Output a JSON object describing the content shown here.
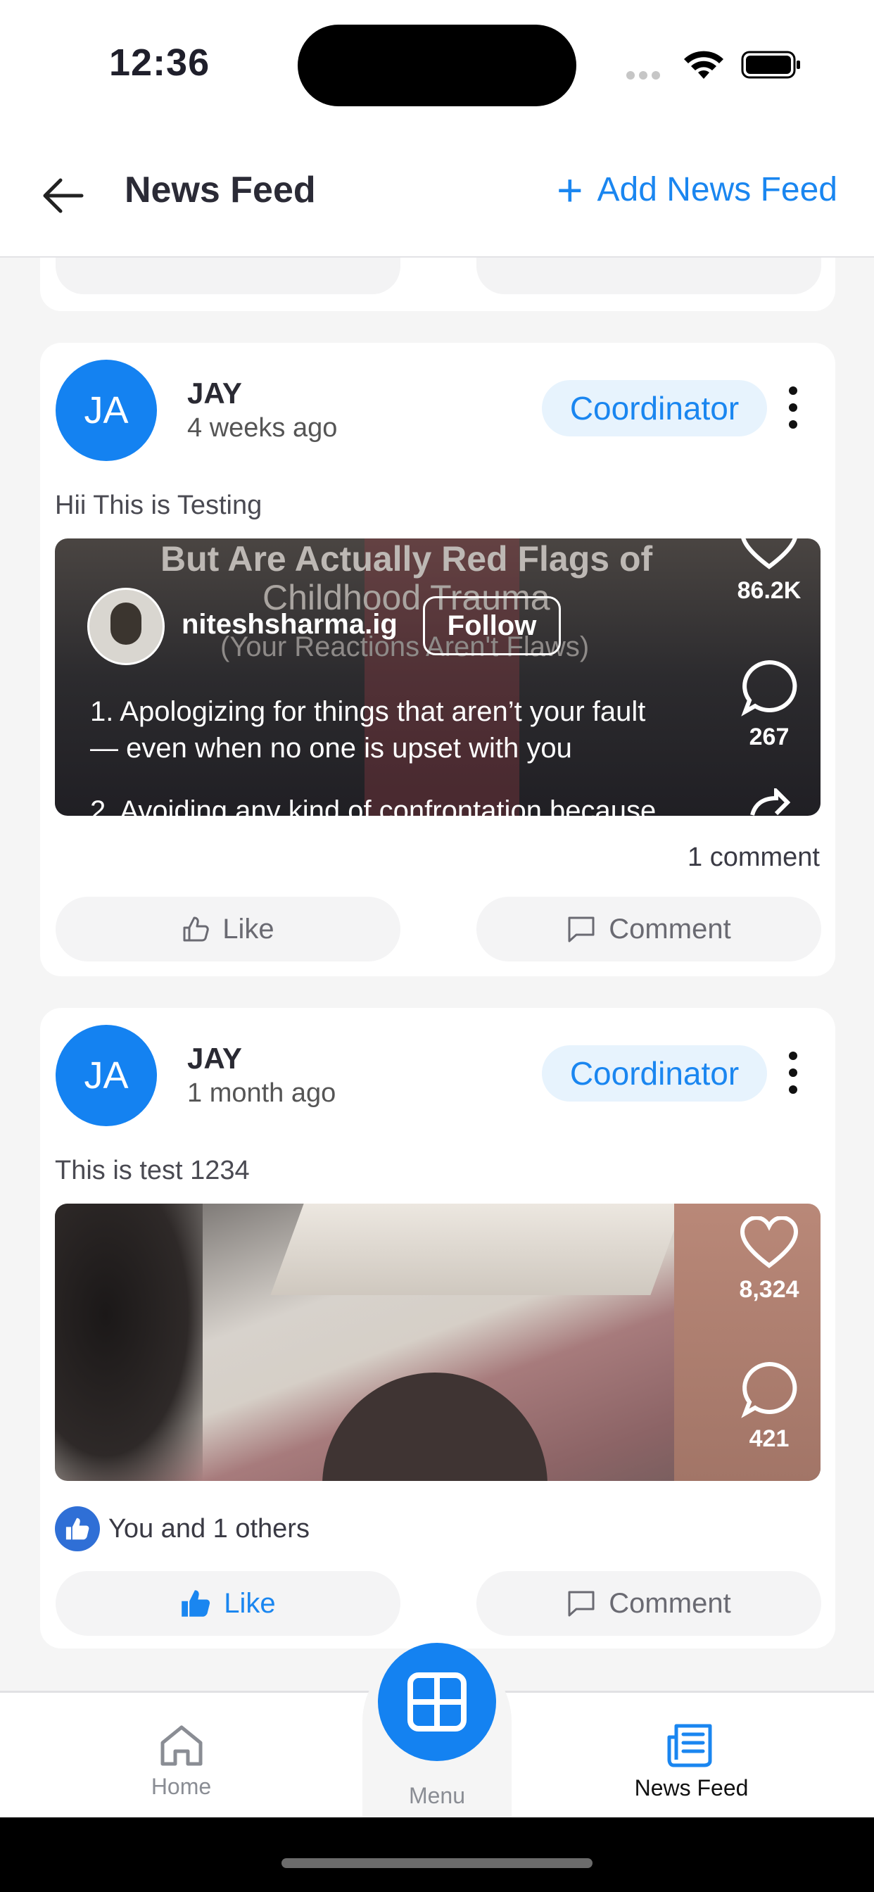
{
  "status_bar": {
    "time": "12:36"
  },
  "header": {
    "title": "News Feed",
    "add_label": "Add News Feed"
  },
  "posts": [
    {
      "initials": "JA",
      "author": "JAY",
      "time_ago": "4 weeks ago",
      "role": "Coordinator",
      "caption": "Hii This is Testing",
      "media": {
        "overlay_title": "But Are Actually Red Flags of",
        "overlay_title2": "Childhood Trauma",
        "overlay_sub": "(Your Reactions Aren't Flaws)",
        "username": "niteshsharma.ig",
        "follow_label": "Follow",
        "line1": "1. Apologizing for things that aren’t your fault",
        "line2": "— even when no one is upset with you",
        "line3": "2. Avoiding any kind of confrontation because",
        "like_count": "86.2K",
        "comment_count": "267"
      },
      "meta": "1 comment",
      "like_label": "Like",
      "comment_label": "Comment"
    },
    {
      "initials": "JA",
      "author": "JAY",
      "time_ago": "1 month ago",
      "role": "Coordinator",
      "caption": "This is test 1234",
      "media": {
        "like_count": "8,324",
        "comment_count": "421"
      },
      "meta": "You and 1 others",
      "like_label": "Like",
      "comment_label": "Comment"
    }
  ],
  "bottom_nav": {
    "home": "Home",
    "menu": "Menu",
    "news_feed": "News Feed"
  },
  "colors": {
    "accent": "#1a86f0",
    "avatar": "#1482f1",
    "like_badge": "#2f6fd6"
  }
}
